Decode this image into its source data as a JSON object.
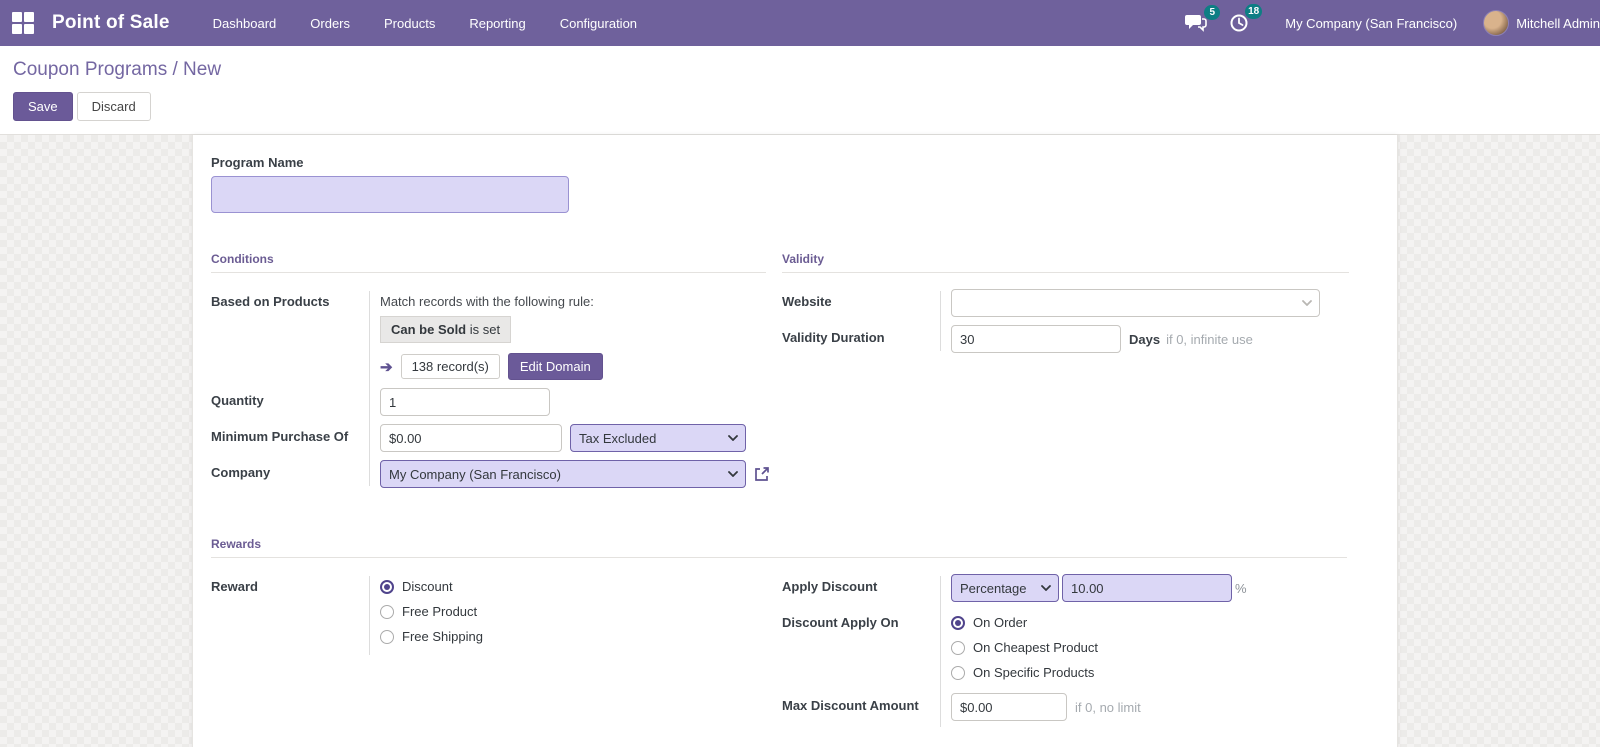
{
  "nav": {
    "brand": "Point of Sale",
    "items": [
      "Dashboard",
      "Orders",
      "Products",
      "Reporting",
      "Configuration"
    ],
    "messages_badge": "5",
    "activities_badge": "18",
    "company": "My Company (San Francisco)",
    "user": "Mitchell Admin"
  },
  "breadcrumb": {
    "parent": "Coupon Programs",
    "separator": " / ",
    "current": "New"
  },
  "actions": {
    "save": "Save",
    "discard": "Discard"
  },
  "icons": {
    "arrow": "➔"
  },
  "colors": {
    "header_purple": "#6f619c",
    "accent_purple": "#6b5a99",
    "lavender_fill": "#dbd7f6",
    "badge_teal": "#0e7e84",
    "section_title_purple": "#6b5c93"
  },
  "form": {
    "program_name": {
      "label": "Program Name",
      "value": ""
    },
    "conditions": {
      "title": "Conditions",
      "based_on_products": {
        "label": "Based on Products",
        "rule_text": "Match records with the following rule:",
        "rule_field": "Can be Sold",
        "rule_op": " is set",
        "records": "138 record(s)",
        "edit_domain": "Edit Domain"
      },
      "quantity": {
        "label": "Quantity",
        "value": "1"
      },
      "min_purchase": {
        "label": "Minimum Purchase Of",
        "value": "$0.00",
        "tax": "Tax Excluded"
      },
      "company": {
        "label": "Company",
        "value": "My Company (San Francisco)"
      }
    },
    "validity": {
      "title": "Validity",
      "website": {
        "label": "Website",
        "value": ""
      },
      "duration": {
        "label": "Validity Duration",
        "value": "30",
        "unit": "Days",
        "hint": "if 0, infinite use"
      }
    },
    "rewards": {
      "title": "Rewards",
      "reward": {
        "label": "Reward",
        "options": [
          "Discount",
          "Free Product",
          "Free Shipping"
        ],
        "selected": "Discount"
      },
      "apply_discount": {
        "label": "Apply Discount",
        "type": "Percentage",
        "value": "10.00",
        "suffix": "%"
      },
      "discount_apply_on": {
        "label": "Discount Apply On",
        "options": [
          "On Order",
          "On Cheapest Product",
          "On Specific Products"
        ],
        "selected": "On Order"
      },
      "max_discount": {
        "label": "Max Discount Amount",
        "value": "$0.00",
        "hint": "if 0, no limit"
      }
    }
  }
}
